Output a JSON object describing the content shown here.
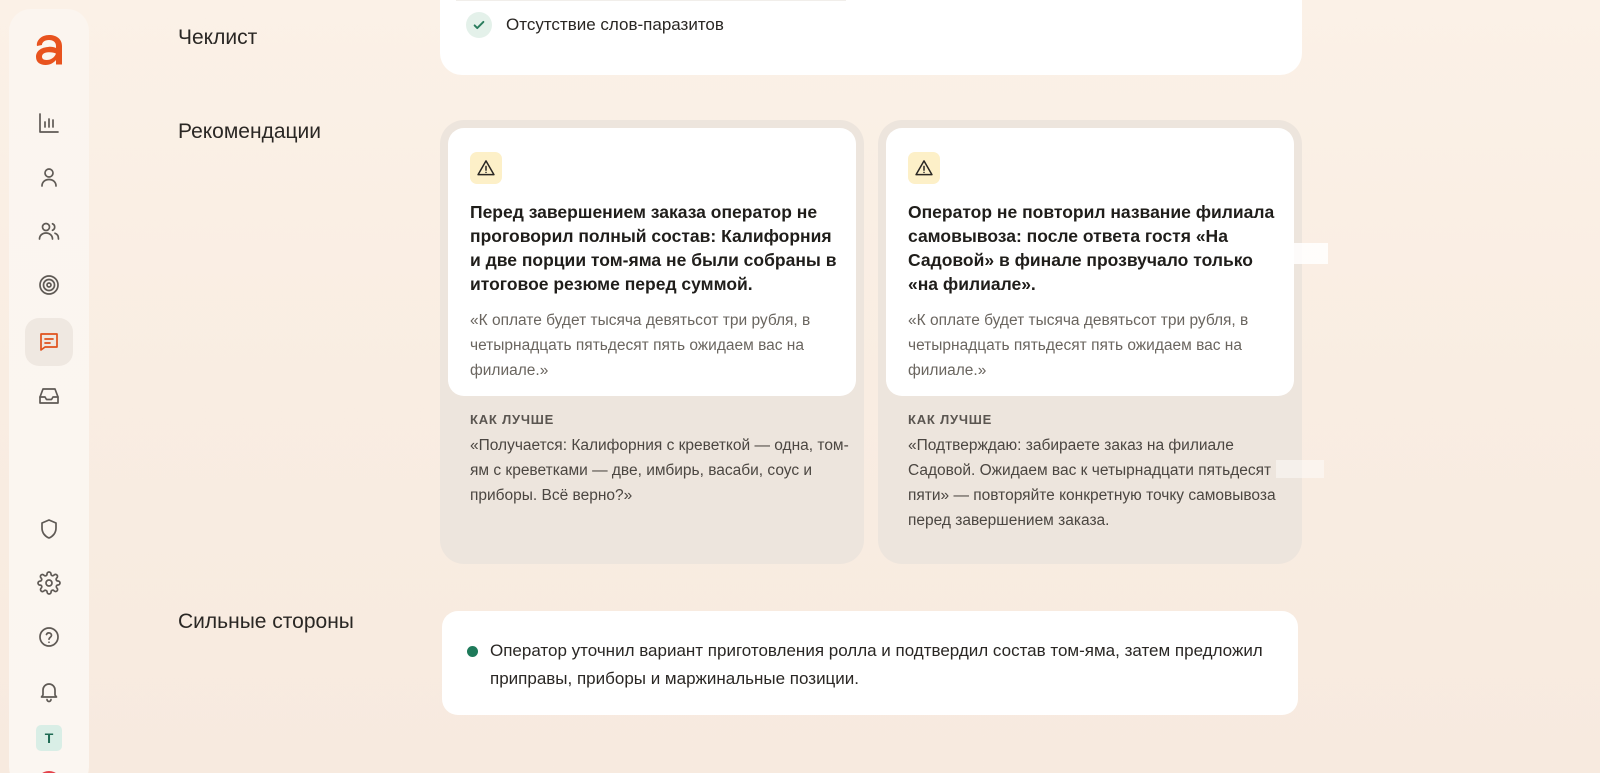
{
  "sections": {
    "checklist_title": "Чеклист",
    "recommendations_title": "Рекомендации",
    "strengths_title": "Сильные стороны"
  },
  "checklist": {
    "items": [
      {
        "label": "Отсутствие слов-паразитов",
        "status": "checked"
      }
    ]
  },
  "recommendations": [
    {
      "icon": "warning-icon",
      "heading": "Перед завершением заказа оператор не проговорил полный состав: Калифорния и две порции том-яма не были собраны в итоговое резюме перед суммой.",
      "quote": "«К оплате будет тысяча девятьсот три рубля, в четырнадцать пятьдесят пять ожидаем вас на филиале.»",
      "better_label": "КАК ЛУЧШЕ",
      "better_text": "«Получается: Калифорния с креветкой — одна, том-ям с креветками — две, имбирь, васаби, соус и приборы. Всё верно?»"
    },
    {
      "icon": "warning-icon",
      "heading": "Оператор не повторил название филиала самовывоза: после ответа гостя «На Садовой» в финале прозвучало только «на филиале».",
      "quote": "«К оплате будет тысяча девятьсот три рубля, в четырнадцать пятьдесят пять ожидаем вас на филиале.»",
      "better_label": "КАК ЛУЧШЕ",
      "better_text": "«Подтверждаю: забираете заказ на филиале Садовой.  Ожидаем вас к четырнадцати пятьдесят пяти» — повторяйте конкретную точку самовывоза перед завершением заказа."
    }
  ],
  "strengths": {
    "items": [
      "Оператор уточнил вариант приготовления ролла и подтвердил состав том-яма, затем предложил приправы, приборы и маржинальные позиции."
    ]
  },
  "sidebar": {
    "items": [
      {
        "icon": "bar-chart-icon"
      },
      {
        "icon": "user-icon"
      },
      {
        "icon": "users-icon"
      },
      {
        "icon": "target-icon"
      },
      {
        "icon": "message-icon",
        "active": true
      },
      {
        "icon": "inbox-icon"
      },
      {
        "icon": "shield-icon"
      },
      {
        "icon": "gear-icon"
      },
      {
        "icon": "help-icon"
      },
      {
        "icon": "bell-icon"
      }
    ],
    "user_initial": "T"
  },
  "colors": {
    "accent": "#e0521c",
    "success": "#1e7a5a",
    "warning_bg": "#fdf0c8"
  }
}
